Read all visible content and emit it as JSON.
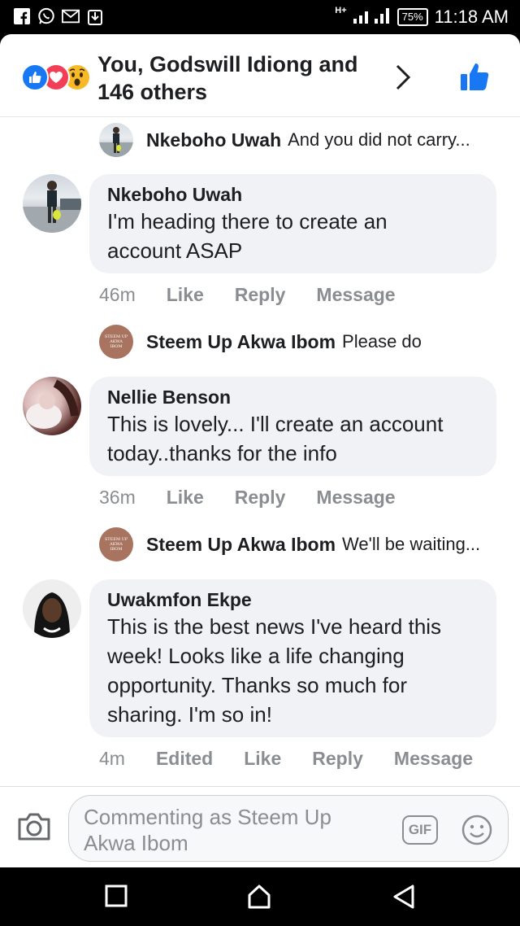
{
  "status_bar": {
    "left_icons": [
      "facebook-icon",
      "whatsapp-icon",
      "gmail-icon",
      "download-icon"
    ],
    "network": "H+",
    "battery": "75%",
    "time": "11:18 AM"
  },
  "reactions": {
    "icons": [
      "like-reaction-icon",
      "love-reaction-icon",
      "wow-reaction-icon"
    ],
    "summary": "You, Godswill Idiong and 146 others",
    "colors": {
      "like": "#1877f2",
      "love": "#f33e58",
      "wow": "#f7b928"
    }
  },
  "thread": [
    {
      "type": "reply-preview",
      "name": "Nkeboho Uwah",
      "text": "And you did not carry..."
    },
    {
      "type": "comment",
      "name": "Nkeboho Uwah",
      "text_lines": [
        "I'm heading there to create an",
        "account ASAP"
      ],
      "time": "46m",
      "actions": [
        "Like",
        "Reply",
        "Message"
      ]
    },
    {
      "type": "reply-preview",
      "name": "Steem Up Akwa Ibom",
      "text": "Please do",
      "avatar_text": "STEEM UP AKWA IBOM"
    },
    {
      "type": "comment",
      "name": "Nellie Benson",
      "text_lines": [
        "This is lovely... I'll create an account",
        "today..thanks for the info"
      ],
      "time": "36m",
      "actions": [
        "Like",
        "Reply",
        "Message"
      ]
    },
    {
      "type": "reply-preview",
      "name": "Steem Up Akwa Ibom",
      "text": "We'll be waiting...",
      "avatar_text": "STEEM UP AKWA IBOM"
    },
    {
      "type": "comment",
      "name": "Uwakmfon Ekpe",
      "text_lines": [
        "This is the best news I've heard this",
        "week! Looks like a life changing",
        "opportunity. Thanks so much for",
        "sharing. I'm so in!"
      ],
      "time": "4m",
      "edited": "Edited",
      "actions": [
        "Like",
        "Reply",
        "Message"
      ]
    }
  ],
  "composer": {
    "placeholder_lines": [
      "Commenting as Steem Up",
      "Akwa Ibom"
    ],
    "gif_label": "GIF"
  },
  "colors": {
    "accent": "#1877f2",
    "bubble": "#f0f2f5",
    "muted": "#8a8d91"
  }
}
